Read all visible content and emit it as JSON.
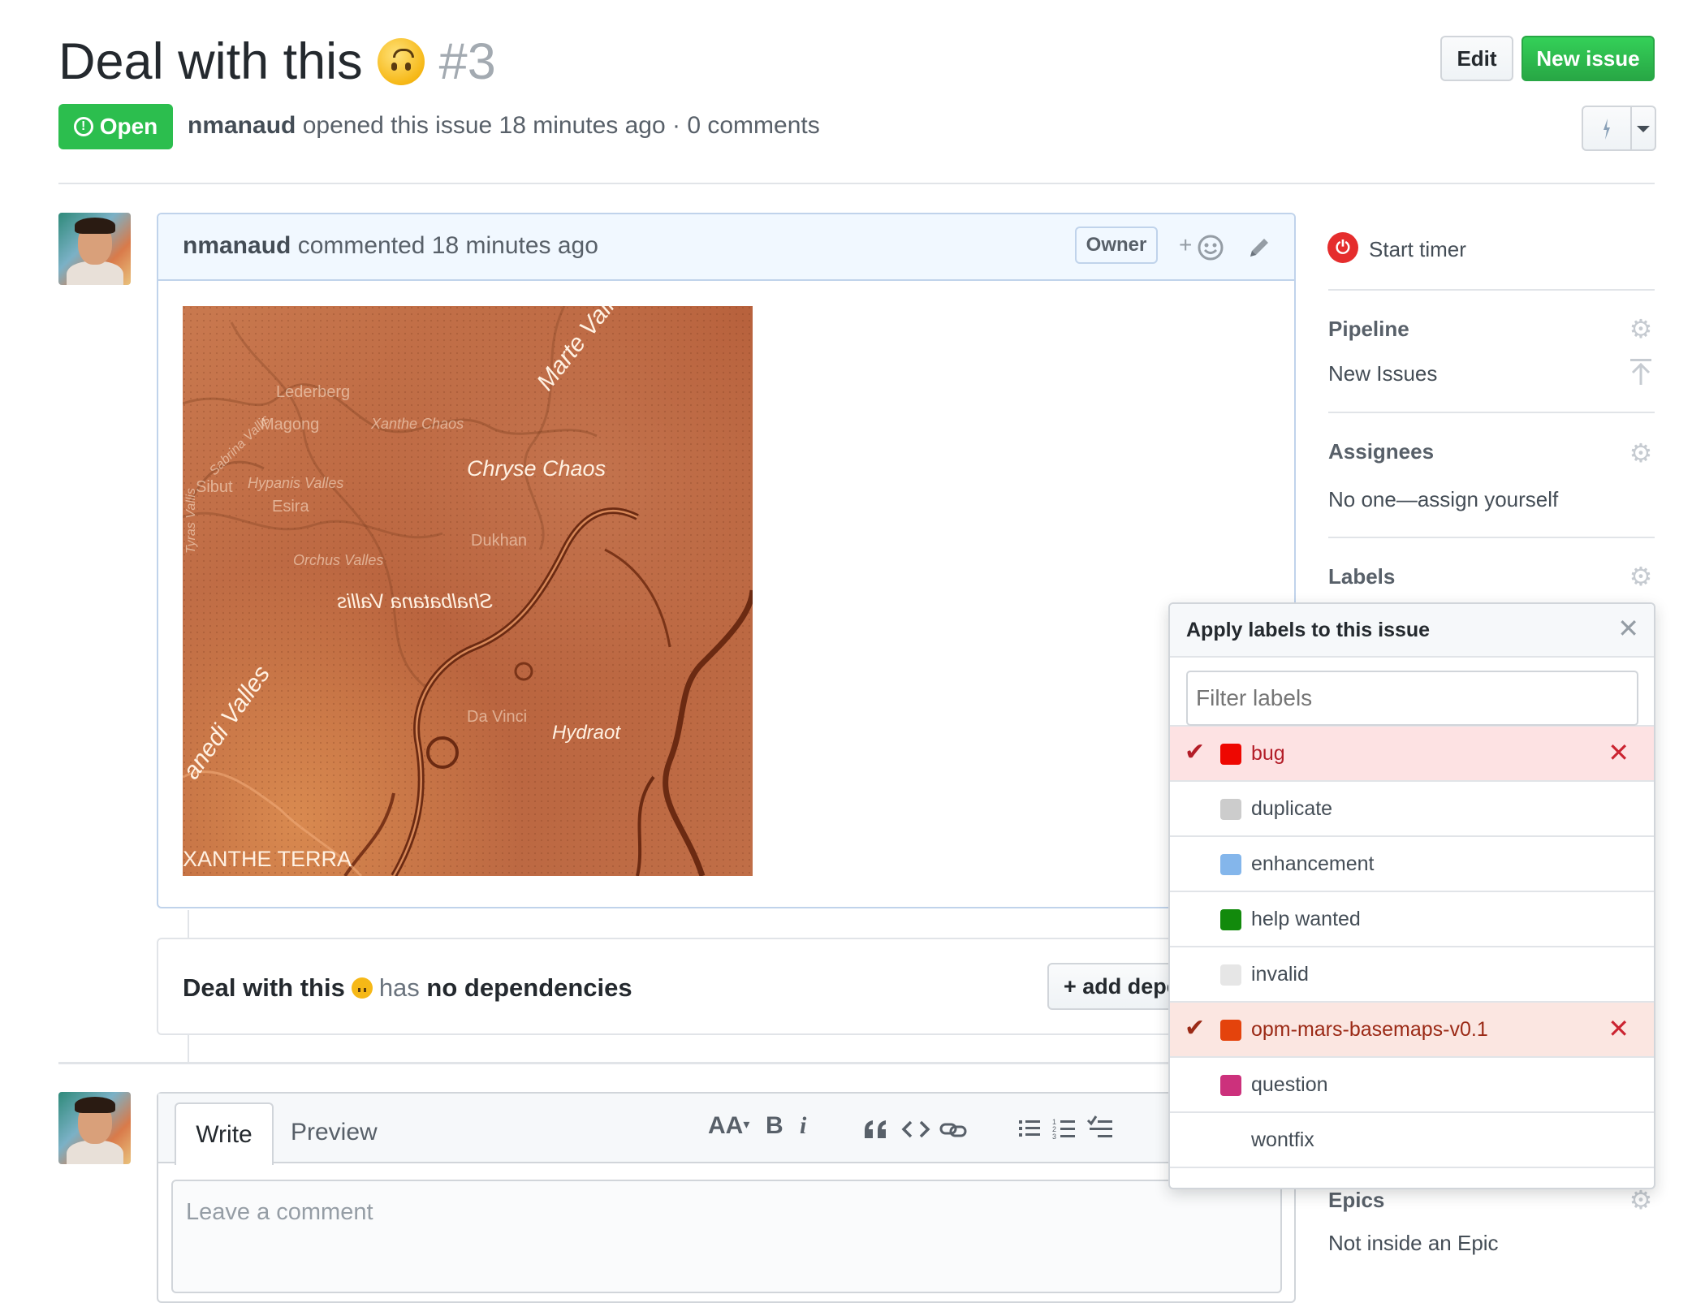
{
  "issue": {
    "title": "Deal with this",
    "number": "#3",
    "status": "Open",
    "author": "nmanaud",
    "meta_text": "opened this issue 18 minutes ago · 0 comments"
  },
  "header_buttons": {
    "edit": "Edit",
    "new_issue": "New issue"
  },
  "comment": {
    "author": "nmanaud",
    "time_text": "commented 18 minutes ago",
    "badge": "Owner",
    "reaction_plus": "+"
  },
  "map_labels": {
    "marte_vallis": "Marte Vallis",
    "chryse_chaos": "Chryse Chaos",
    "shalbatana_vallis": "Shalbatana Vallis",
    "maja_valles": "anedi Valles",
    "xanthe_terra": "XANTHE TERRA",
    "lederberg": "Lederberg",
    "magong": "Magong",
    "xanthe_chaos": "Xanthe Chaos",
    "sabrina_vallis": "Sabrina Vallis",
    "sibut": "Sibut",
    "hypanis_valles": "Hypanis Valles",
    "esira": "Esira",
    "tyras_vallis": "Tyras Vallis",
    "dukhan": "Dukhan",
    "orchus_valles": "Orchus Valles",
    "da_vinci": "Da Vinci",
    "hydraotes": "Hydraot"
  },
  "dependencies": {
    "title": "Deal with this",
    "mid": "has",
    "tail": "no dependencies",
    "add_button": "+ add dependency"
  },
  "editor": {
    "tab_write": "Write",
    "tab_preview": "Preview",
    "placeholder": "Leave a comment",
    "tools": {
      "heading": "AA",
      "bold": "B",
      "italic": "i"
    }
  },
  "sidebar": {
    "timer": "Start timer",
    "pipeline_label": "Pipeline",
    "pipeline_value": "New Issues",
    "assignees_label": "Assignees",
    "assignees_value": "No one—assign yourself",
    "labels_label": "Labels",
    "epics_label": "Epics",
    "epics_value": "Not inside an Epic"
  },
  "labels_dropdown": {
    "title": "Apply labels to this issue",
    "filter_placeholder": "Filter labels",
    "items": [
      {
        "name": "bug",
        "color": "#ee0701",
        "selected": true
      },
      {
        "name": "duplicate",
        "color": "#cccccc",
        "selected": false
      },
      {
        "name": "enhancement",
        "color": "#84b6eb",
        "selected": false
      },
      {
        "name": "help wanted",
        "color": "#128a0c",
        "selected": false
      },
      {
        "name": "invalid",
        "color": "#e6e6e6",
        "selected": false
      },
      {
        "name": "opm-mars-basemaps-v0.1",
        "color": "#e4430c",
        "selected": true
      },
      {
        "name": "question",
        "color": "#cc317c",
        "selected": false
      },
      {
        "name": "wontfix",
        "color": "#ffffff",
        "selected": false
      }
    ]
  },
  "colors": {
    "open_green": "#2cbe4e",
    "new_issue_green": "#28a745",
    "timer_red": "#e52d2d",
    "comment_header_bg": "#f1f8ff"
  }
}
